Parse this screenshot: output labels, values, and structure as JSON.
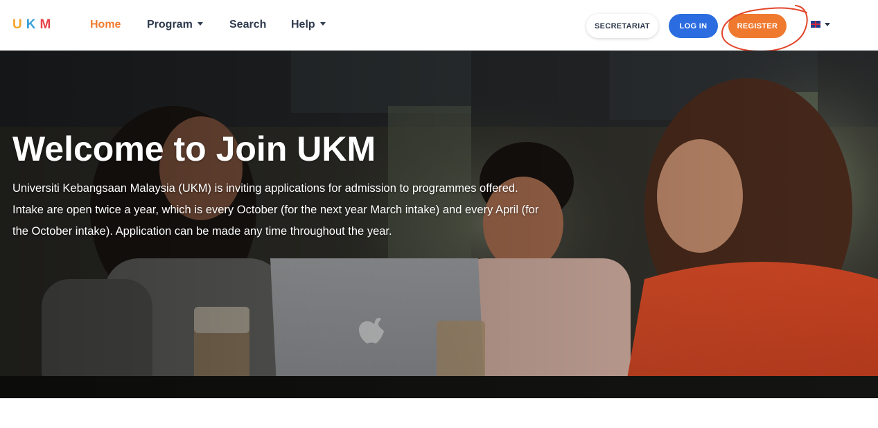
{
  "header": {
    "logo": [
      "U",
      "K",
      "M"
    ],
    "nav": {
      "home": "Home",
      "program": "Program",
      "search": "Search",
      "help": "Help"
    },
    "buttons": {
      "secretariat": "SECRETARIAT",
      "login": "LOG IN",
      "register": "REGISTER"
    },
    "language_icon": "uk-flag-icon"
  },
  "hero": {
    "title": "Welcome to Join UKM",
    "description": "Universiti Kebangsaan Malaysia (UKM) is inviting applications for admission to programmes offered. Intake are open twice a year, which is every October (for the next year March intake) and every April (for the October intake). Application can be made any time throughout the year."
  },
  "colors": {
    "accent": "#ef7a2f",
    "primary": "#2b6de0",
    "text": "#2e3a4d",
    "logo_u": "#f2a62a",
    "logo_k": "#3aa0d8",
    "logo_m": "#e5434a",
    "annotation": "#e2462b"
  }
}
